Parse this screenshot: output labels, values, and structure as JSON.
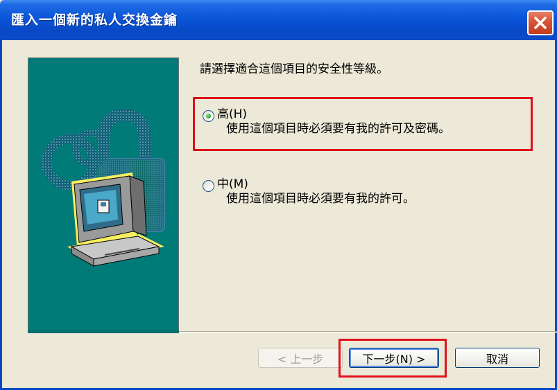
{
  "window": {
    "title": "匯入一個新的私人交換金鑰"
  },
  "content": {
    "prompt": "請選擇適合這個項目的安全性等級。",
    "options": [
      {
        "label": "高(H)",
        "description": "使用這個項目時必須要有我的許可及密碼。",
        "selected": true
      },
      {
        "label": "中(M)",
        "description": "使用這個項目時必須要有我的許可。",
        "selected": false
      }
    ]
  },
  "buttons": {
    "back": "< 上一步",
    "next": "下一步(N) >",
    "cancel": "取消"
  },
  "icons": {
    "close": "close-icon",
    "illustration": "security-computer-lock-icon"
  },
  "colors": {
    "titlebar": "#0a55d8",
    "side_panel": "#007b78",
    "highlight": "#e0101c"
  }
}
